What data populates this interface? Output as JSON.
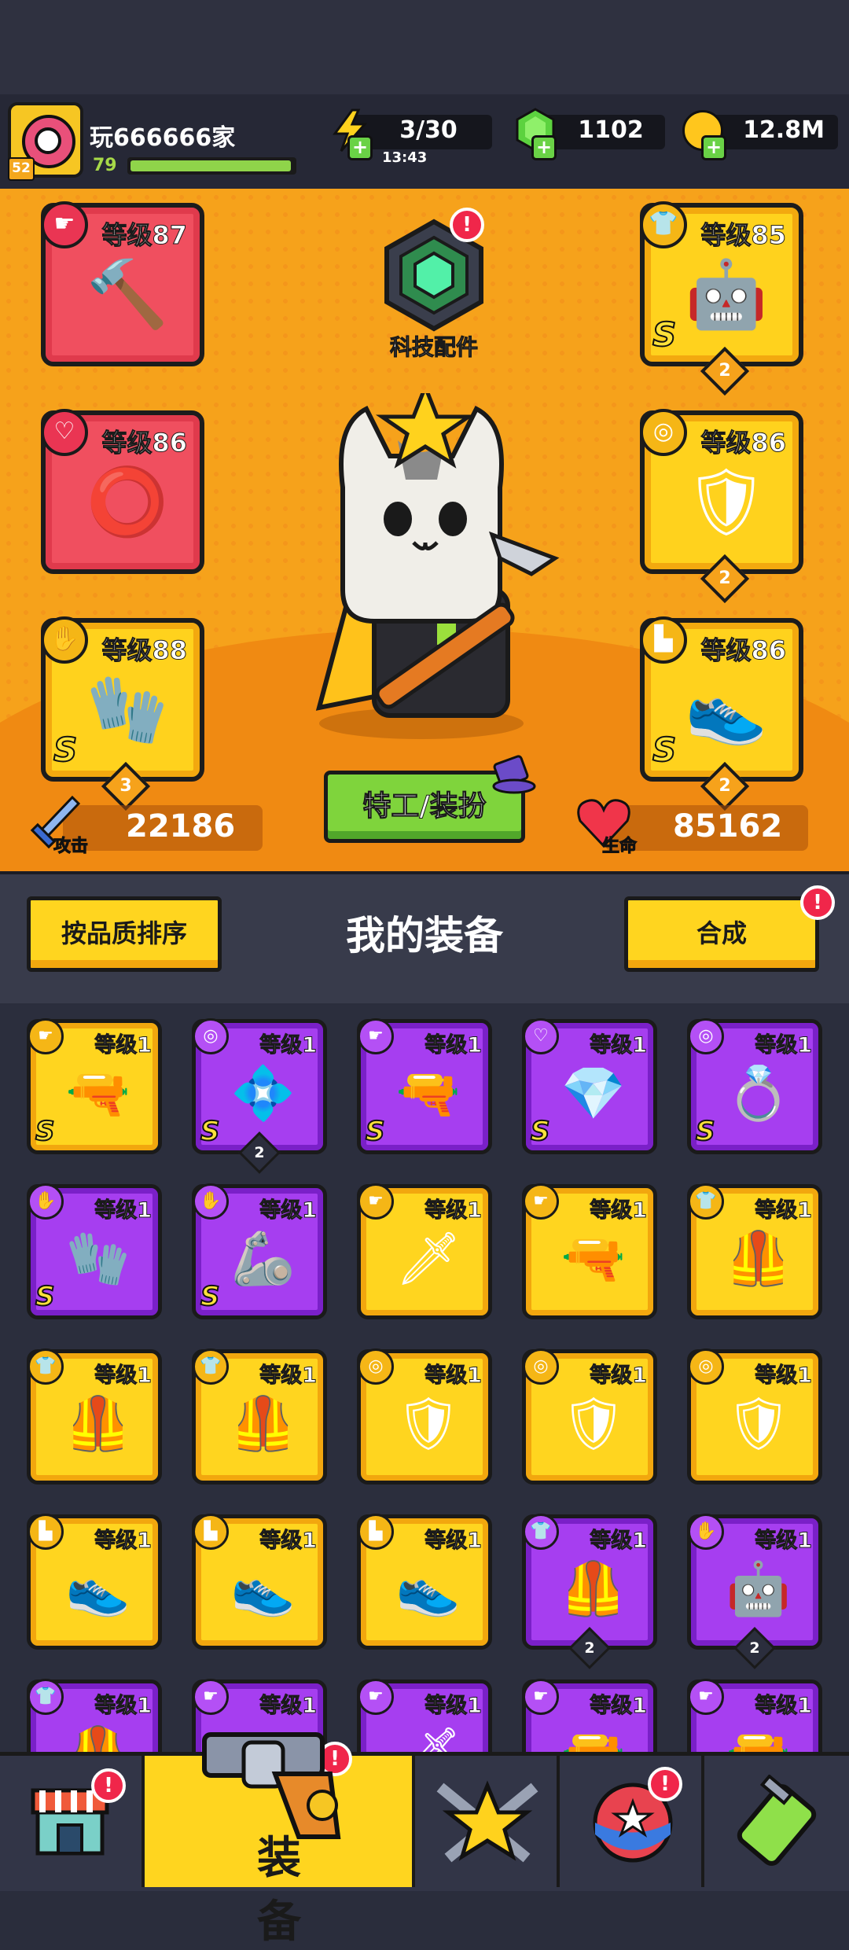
{
  "player": {
    "name": "玩666666家",
    "level": "79",
    "badge": "52",
    "xp_fraction": 0.95
  },
  "resources": {
    "energy": {
      "value": "3/30",
      "timer": "13:43",
      "icon": "lightning-icon"
    },
    "gems": {
      "value": "1102",
      "icon": "gem-icon"
    },
    "coins": {
      "value": "12.8M",
      "icon": "coin-icon"
    }
  },
  "tech": {
    "label": "科技配件",
    "alert": "!"
  },
  "slots": {
    "weapon": {
      "level": "等级87",
      "icon": "pickaxe-icon",
      "type_icon": "gun-type-icon",
      "type_glyph": "☛",
      "pic": "🔨"
    },
    "necklace": {
      "level": "等级86",
      "icon": "spiked-collar-icon",
      "type_icon": "necklace-type-icon",
      "type_glyph": "♡",
      "pic": "⭕"
    },
    "glove": {
      "level": "等级88",
      "icon": "mech-glove-icon",
      "type_icon": "glove-type-icon",
      "type_glyph": "✋",
      "pic": "🧤",
      "grade": "S",
      "count": "3"
    },
    "armor": {
      "level": "等级85",
      "icon": "mech-armor-icon",
      "type_icon": "armor-type-icon",
      "type_glyph": "👕",
      "pic": "🤖",
      "grade": "S",
      "count": "2"
    },
    "belt": {
      "level": "等级86",
      "icon": "belt-icon",
      "type_icon": "belt-type-icon",
      "type_glyph": "◎",
      "pic": "🛡",
      "count": "2"
    },
    "boots": {
      "level": "等级86",
      "icon": "boots-icon",
      "type_icon": "boots-type-icon",
      "type_glyph": "▙",
      "pic": "👟",
      "grade": "S",
      "count": "2"
    }
  },
  "stats": {
    "attack_label": "攻击",
    "attack": "22186",
    "hp_label": "生命",
    "hp": "85162"
  },
  "skin_button": "特工/装扮",
  "equip_header": {
    "sort_button": "按品质排序",
    "title": "我的装备",
    "merge_button": "合成",
    "merge_alert": "!"
  },
  "items": [
    {
      "rarity": "gold",
      "level": "等级1",
      "type": "☛",
      "pic": "🔫",
      "grade": "S",
      "name": "blaster-icon"
    },
    {
      "rarity": "purple",
      "level": "等级1",
      "type": "◎",
      "pic": "💠",
      "grade": "S",
      "count": "2",
      "name": "armor-belt-icon"
    },
    {
      "rarity": "purple",
      "level": "等级1",
      "type": "☛",
      "pic": "🔫",
      "grade": "S",
      "name": "blaster-icon"
    },
    {
      "rarity": "purple",
      "level": "等级1",
      "type": "♡",
      "pic": "💎",
      "grade": "S",
      "name": "chain-necklace-icon"
    },
    {
      "rarity": "purple",
      "level": "等级1",
      "type": "◎",
      "pic": "💍",
      "grade": "S",
      "name": "belt-icon"
    },
    {
      "rarity": "purple",
      "level": "等级1",
      "type": "✋",
      "pic": "🧤",
      "grade": "S",
      "name": "mech-glove-icon"
    },
    {
      "rarity": "purple",
      "level": "等级1",
      "type": "✋",
      "pic": "🦾",
      "grade": "S",
      "name": "claw-glove-icon"
    },
    {
      "rarity": "gold",
      "level": "等级1",
      "type": "☛",
      "pic": "🗡",
      "name": "kunai-icon"
    },
    {
      "rarity": "gold",
      "level": "等级1",
      "type": "☛",
      "pic": "🔫",
      "name": "revolver-icon"
    },
    {
      "rarity": "gold",
      "level": "等级1",
      "type": "👕",
      "pic": "🦺",
      "name": "vest-icon"
    },
    {
      "rarity": "gold",
      "level": "等级1",
      "type": "👕",
      "pic": "🦺",
      "name": "vest-icon"
    },
    {
      "rarity": "gold",
      "level": "等级1",
      "type": "👕",
      "pic": "🦺",
      "name": "vest-icon"
    },
    {
      "rarity": "gold",
      "level": "等级1",
      "type": "◎",
      "pic": "🛡",
      "name": "belt-icon"
    },
    {
      "rarity": "gold",
      "level": "等级1",
      "type": "◎",
      "pic": "🛡",
      "name": "belt-icon"
    },
    {
      "rarity": "gold",
      "level": "等级1",
      "type": "◎",
      "pic": "🛡",
      "name": "belt-icon"
    },
    {
      "rarity": "gold",
      "level": "等级1",
      "type": "▙",
      "pic": "👟",
      "name": "sneaker-icon"
    },
    {
      "rarity": "gold",
      "level": "等级1",
      "type": "▙",
      "pic": "👟",
      "name": "sneaker-icon"
    },
    {
      "rarity": "gold",
      "level": "等级1",
      "type": "▙",
      "pic": "👟",
      "name": "sneaker-icon"
    },
    {
      "rarity": "purple",
      "level": "等级1",
      "type": "👕",
      "pic": "🦺",
      "count": "2",
      "name": "vest-icon"
    },
    {
      "rarity": "purple",
      "level": "等级1",
      "type": "✋",
      "pic": "🤖",
      "count": "2",
      "name": "robot-glove-icon"
    },
    {
      "rarity": "purple",
      "level": "等级1",
      "type": "👕",
      "pic": "🦺",
      "name": "vest-icon"
    },
    {
      "rarity": "purple",
      "level": "等级1",
      "type": "☛",
      "pic": "🔫",
      "name": "gun-icon"
    },
    {
      "rarity": "purple",
      "level": "等级1",
      "type": "☛",
      "pic": "🗡",
      "name": "blade-icon"
    },
    {
      "rarity": "purple",
      "level": "等级1",
      "type": "☛",
      "pic": "🔫",
      "name": "gun-icon"
    },
    {
      "rarity": "purple",
      "level": "等级1",
      "type": "☛",
      "pic": "🔫",
      "name": "gun-icon"
    }
  ],
  "nav": {
    "shop": {
      "icon": "shop-icon",
      "alert": "!"
    },
    "equip": {
      "icon": "revolver-icon",
      "label": "装备",
      "alert": "!"
    },
    "battle": {
      "icon": "crossed-swords-star-icon"
    },
    "gacha": {
      "icon": "star-ball-icon",
      "alert": "!"
    },
    "lab": {
      "icon": "battery-icon"
    }
  },
  "colors": {
    "hero_bg": "#f6a21b",
    "gold": "#ffd51f",
    "purple": "#a63ef0",
    "red_slot": "#f04f5f",
    "green": "#7fd43c",
    "alert": "#f0264a"
  }
}
